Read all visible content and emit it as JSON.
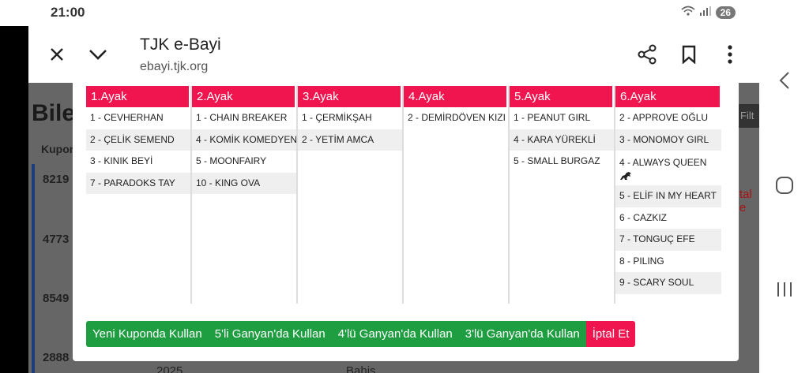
{
  "status": {
    "time": "21:00",
    "battery": "26"
  },
  "browser": {
    "title": "TJK e-Bayi",
    "url": "ebayi.tjk.org"
  },
  "background": {
    "heading": "Bilet",
    "column": "Kupon",
    "ids": [
      "8219",
      "4773",
      "8549",
      "2888"
    ],
    "red_text": "tal e",
    "filter": "Filt",
    "bottom_left": "2025",
    "bottom_mid": "Bahis"
  },
  "legs": [
    {
      "title": "1.Ayak",
      "horses": [
        "1 - CEVHERHAN",
        "2 - ÇELİK SEMEND",
        "3 - KINIK BEYİ",
        "7 - PARADOKS TAY"
      ]
    },
    {
      "title": "2.Ayak",
      "horses": [
        "1 - CHAIN BREAKER",
        "4 - KOMİK KOMEDYEN",
        "5 - MOONFAIRY",
        "10 - KING OVA"
      ]
    },
    {
      "title": "3.Ayak",
      "horses": [
        "1 - ÇERMİKŞAH",
        "2 - YETİM AMCA"
      ]
    },
    {
      "title": "4.Ayak",
      "horses": [
        "2 - DEMİRDÖVEN KIZI"
      ]
    },
    {
      "title": "5.Ayak",
      "horses": [
        "1 - PEANUT GIRL",
        "4 - KARA YÜREKLİ",
        "5 - SMALL BURGAZ"
      ]
    },
    {
      "title": "6.Ayak",
      "horses": [
        "2 - APPROVE OĞLU",
        "3 - MONOMOY GIRL",
        "4 - ALWAYS QUEEN",
        "5 - ELİF IN MY HEART",
        "6 - CAZKIZ",
        "7 - TONGUÇ EFE",
        "8 - PILING",
        "9 - SCARY SOUL"
      ]
    }
  ],
  "buttons": {
    "new_coupon": "Yeni Kuponda Kullan",
    "ganyan5": "5'li Ganyan'da Kullan",
    "ganyan4": "4'lü Ganyan'da Kullan",
    "ganyan3": "3'lü Ganyan'da Kullan",
    "cancel": "İptal Et"
  },
  "colors": {
    "accent": "#f0154e",
    "green": "#1e9e41"
  }
}
